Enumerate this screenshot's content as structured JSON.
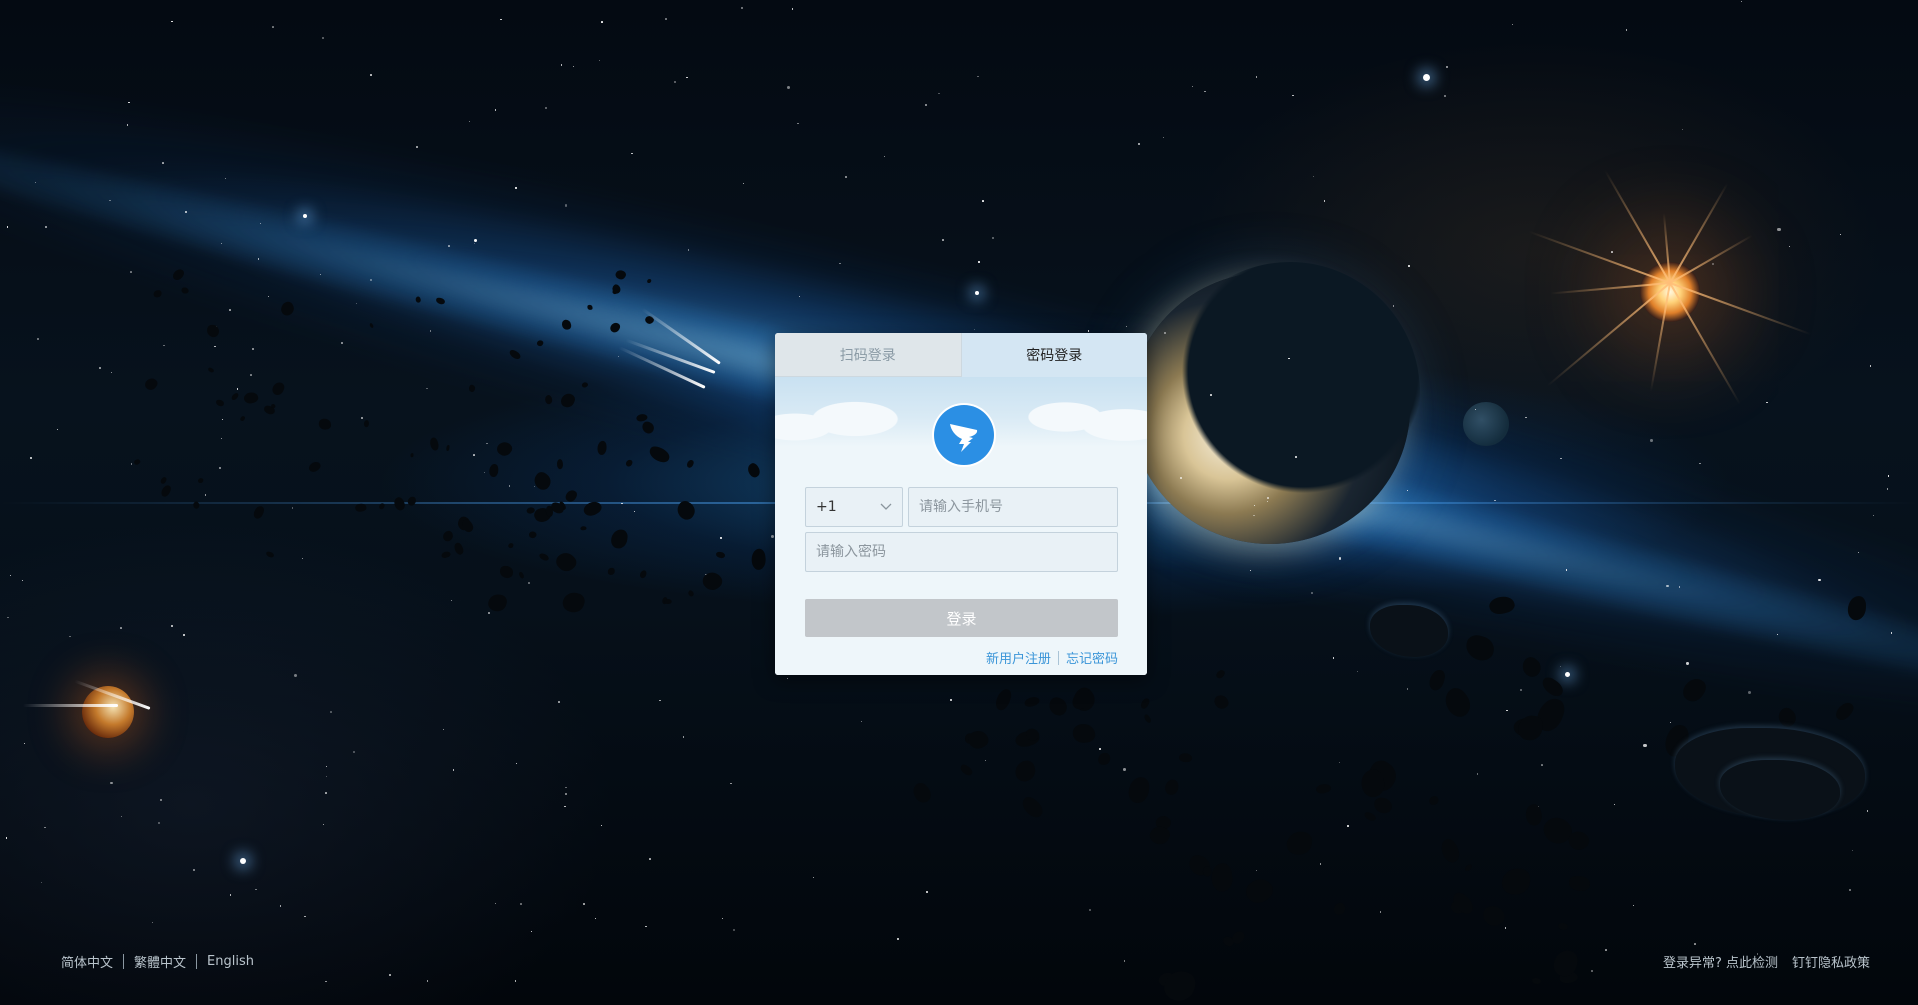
{
  "tabs": {
    "qr_label": "扫码登录",
    "password_label": "密码登录"
  },
  "form": {
    "country_code": "+1",
    "phone_placeholder": "请输入手机号",
    "password_placeholder": "请输入密码",
    "login_label": "登录"
  },
  "links": {
    "register": "新用户注册",
    "forgot": "忘记密码"
  },
  "footer": {
    "languages": [
      "简体中文",
      "繁體中文",
      "English"
    ],
    "login_issue": "登录异常? 点此检测",
    "privacy": "钉钉隐私政策"
  },
  "colors": {
    "accent": "#3a95d8",
    "logo_blue": "#2b8fe4",
    "button_disabled": "#c2c6ca"
  },
  "icons": {
    "logo": "dingtalk-logo-icon",
    "dropdown": "chevron-down-icon"
  }
}
